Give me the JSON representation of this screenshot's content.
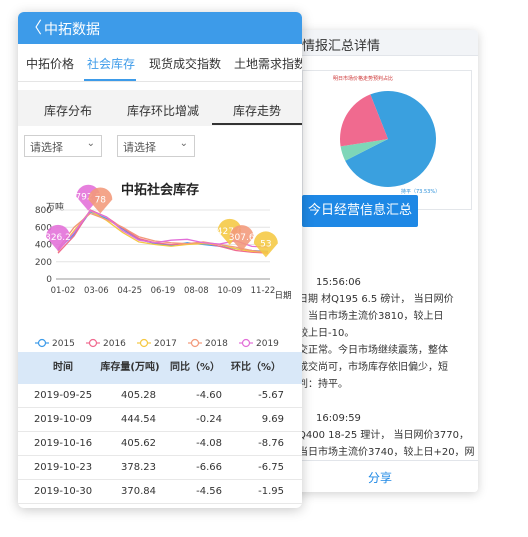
{
  "back": {
    "title": "情报汇总详情",
    "pie_title": "明日市场价格走势预判占比",
    "pie_legend": "持平（73.53%）",
    "button": "今日经营信息汇总",
    "news": [
      "15:56:06",
      "日期 材Q195 6.5 磅计， 当日网价",
      "，当日市场主流价3810，较上日",
      "较上日-10。",
      "交正常。今日市场继续震荡，整体",
      "成交尚可，市场库存依旧偏少，短",
      "判：持平。",
      "16:09:59",
      "Q400 18-25 理计， 当日网价3770，",
      "当日市场主流价3740，较上日+20，网"
    ],
    "share": "分享"
  },
  "front": {
    "app_title": "中拓数据",
    "back_glyph": "〈",
    "tabs": [
      "中拓价格",
      "社会库存",
      "现货成交指数",
      "土地需求指数"
    ],
    "subtabs": [
      "库存分布",
      "库存环比增减",
      "库存走势"
    ],
    "selects": [
      "请选择",
      "请选择"
    ],
    "chevron": "⌄",
    "table": {
      "headers": [
        "时间",
        "库存量(万吨)",
        "同比（%）",
        "环比（%）"
      ],
      "rows": [
        [
          "2019-09-25",
          "405.28",
          "-4.60",
          "-5.67"
        ],
        [
          "2019-10-09",
          "444.54",
          "-0.24",
          "9.69"
        ],
        [
          "2019-10-16",
          "405.62",
          "-4.08",
          "-8.76"
        ],
        [
          "2019-10-23",
          "378.23",
          "-6.66",
          "-6.75"
        ],
        [
          "2019-10-30",
          "370.84",
          "-4.56",
          "-1.95"
        ]
      ]
    }
  },
  "chart_data": {
    "type": "line",
    "title": "中拓社会库存",
    "ylabel": "万吨",
    "xlabel": "日期",
    "ylim": [
      0,
      800
    ],
    "yticks": [
      "0",
      "200",
      "400",
      "600",
      "800"
    ],
    "xticks": [
      "01-02",
      "03-06",
      "04-25",
      "06-19",
      "08-08",
      "10-09",
      "11-22"
    ],
    "series": [
      {
        "name": "2015",
        "color": "#3d9be9",
        "values": [
          340,
          520,
          780,
          700,
          580,
          460,
          410,
          390,
          420,
          400,
          380,
          350,
          330,
          320
        ]
      },
      {
        "name": "2016",
        "color": "#f06a8f",
        "values": [
          300,
          500,
          800,
          720,
          590,
          470,
          420,
          400,
          410,
          420,
          380,
          330,
          310,
          300
        ]
      },
      {
        "name": "2017",
        "color": "#f5c842",
        "values": [
          320,
          560,
          790,
          680,
          540,
          430,
          400,
          380,
          400,
          410,
          400,
          350,
          320,
          310
        ]
      },
      {
        "name": "2018",
        "color": "#f2997a",
        "values": [
          350,
          600,
          760,
          690,
          600,
          490,
          440,
          420,
          410,
          430,
          400,
          370,
          330,
          310
        ]
      },
      {
        "name": "2019",
        "color": "#e26ed8",
        "values": [
          326,
          540,
          792,
          720,
          560,
          450,
          420,
          450,
          460,
          420,
          405,
          444,
          378,
          371
        ]
      }
    ],
    "pins": [
      {
        "label": "326.2",
        "series": "2019",
        "color": "#e26ed8"
      },
      {
        "label": "792.5",
        "series": "2019",
        "color": "#e26ed8"
      },
      {
        "label": "78",
        "series": "2018",
        "color": "#f2997a"
      },
      {
        "label": "427.0",
        "series": "2017",
        "color": "#f5c842"
      },
      {
        "label": "307.6",
        "series": "2018",
        "color": "#f2997a"
      },
      {
        "label": "53",
        "series": "2017",
        "color": "#f5c842"
      }
    ],
    "pie": {
      "slices": [
        {
          "label": "持平",
          "value": 73.53,
          "color": "#3aa0df"
        },
        {
          "label": "",
          "value": 5,
          "color": "#7ed6b8"
        },
        {
          "label": "",
          "value": 21.47,
          "color": "#f06a8f"
        }
      ]
    }
  }
}
